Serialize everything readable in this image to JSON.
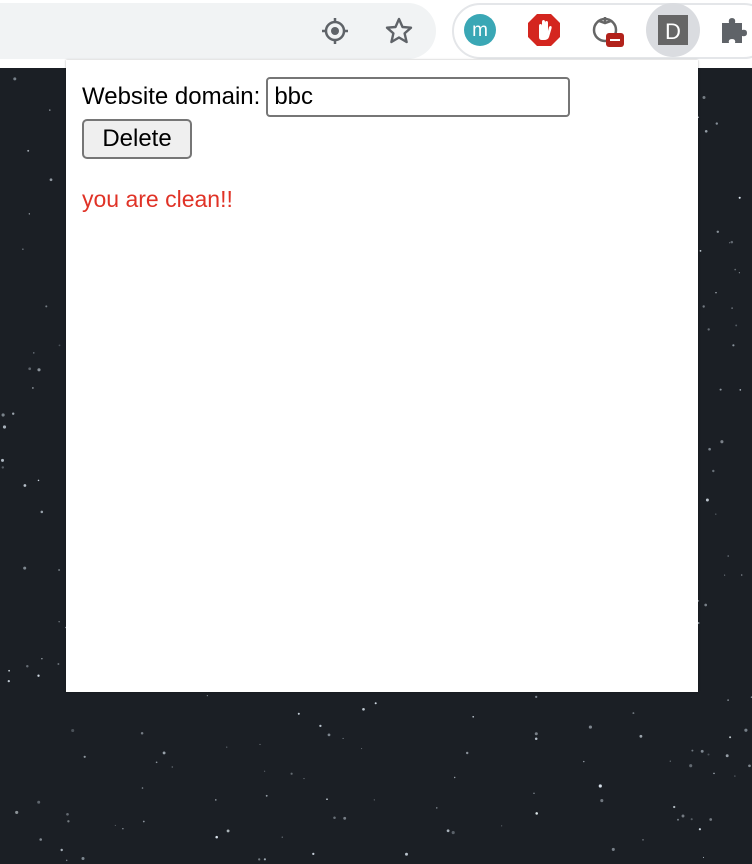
{
  "toolbar": {
    "omnibox_icons": [
      "crosshair-icon",
      "star-icon"
    ],
    "extensions": [
      {
        "name": "m-extension-icon",
        "letter": "m",
        "color": "#3aa7b5"
      },
      {
        "name": "stop-hand-extension-icon",
        "color": "#d4261f"
      },
      {
        "name": "tomato-extension-icon",
        "badge_color": "#b2221b"
      },
      {
        "name": "d-extension-icon",
        "letter": "D",
        "color": "#666666"
      },
      {
        "name": "puzzle-extensions-icon"
      }
    ]
  },
  "popup": {
    "domain_label": "Website domain:",
    "domain_value": "bbc",
    "delete_label": "Delete",
    "status_text": "you are clean!!",
    "status_color": "#e03226"
  }
}
